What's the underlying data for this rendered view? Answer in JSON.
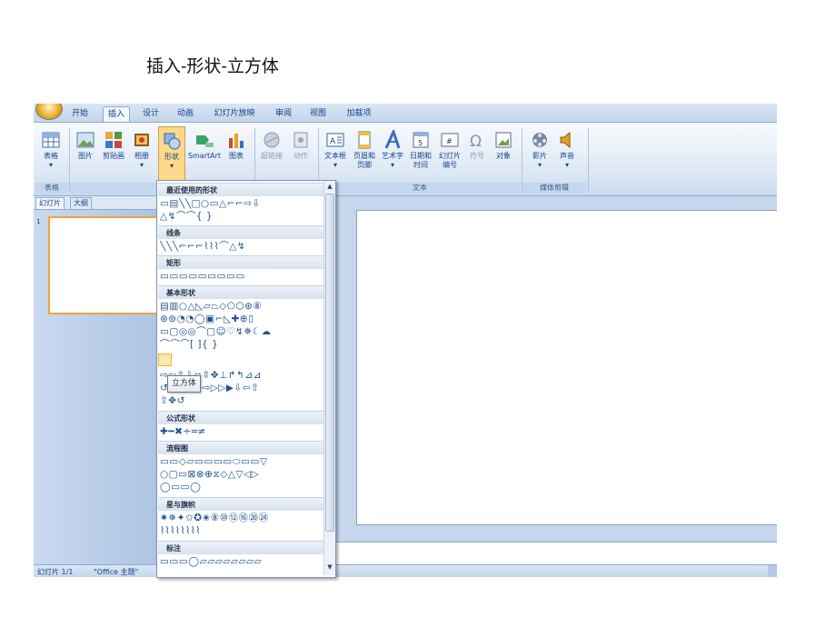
{
  "caption": "插入-形状-立方体",
  "tabs": [
    {
      "label": "开始"
    },
    {
      "label": "插入"
    },
    {
      "label": "设计"
    },
    {
      "label": "动画"
    },
    {
      "label": "幻灯片放映"
    },
    {
      "label": "审阅"
    },
    {
      "label": "视图"
    },
    {
      "label": "加载项"
    }
  ],
  "ribbon": {
    "table": {
      "label": "表格",
      "group": "表格"
    },
    "picture": {
      "label": "图片"
    },
    "clipart": {
      "label": "剪贴画"
    },
    "album": {
      "label": "相册"
    },
    "shapes": {
      "label": "形状"
    },
    "smartart": {
      "label": "SmartArt"
    },
    "chart": {
      "label": "图表"
    },
    "hyperlink": {
      "label": "超链接"
    },
    "action": {
      "label": "动作"
    },
    "textbox": {
      "label": "文本框"
    },
    "header": {
      "label1": "页眉和",
      "label2": "页脚"
    },
    "wordart": {
      "label": "艺术字"
    },
    "datetime": {
      "label1": "日期和",
      "label2": "时间"
    },
    "slidenum": {
      "label1": "幻灯片",
      "label2": "编号"
    },
    "symbol": {
      "label": "符号"
    },
    "object": {
      "label": "对象"
    },
    "movie": {
      "label": "影片"
    },
    "sound": {
      "label": "声音"
    },
    "group_text": "文本",
    "group_media": "媒体剪辑",
    "group_illus_partial": "插"
  },
  "pane": {
    "tab_slides": "幻灯片",
    "tab_outline": "大纲",
    "slide_number": "1"
  },
  "status": {
    "slide": "幻灯片 1/1",
    "theme": "\"Office 主题\""
  },
  "shapes_menu": {
    "sections": [
      {
        "title": "最近使用的形状",
        "rows": [
          "▭▤╲╲□○▭△⌐⌐⇨⇩",
          "△↯⌒⌒{ }"
        ]
      },
      {
        "title": "线条",
        "rows": [
          "╲╲╲⌐⌐⌐⌇⌇⌇⌒△↯"
        ]
      },
      {
        "title": "矩形",
        "rows": [
          "▭▭▭▭▭▭▭▭▭"
        ]
      },
      {
        "title": "基本形状",
        "rows": [
          "▤▥○△◺▱⏢◇⬠⬡⊛⑧",
          "⊛⊚◔◔◯▣⌐◺✚⊕▯",
          "▭▢◎◎⌒▢☺♡↯✵☾☁",
          "⌒⌒⌒[ ]{ }"
        ]
      },
      {
        "title": "",
        "rows": [
          "⇨⇦⇧⇩⬄⇳✥⊥↱↰⊿⊿",
          "↺↻↶↷⇨⇨▷▷▶⇩⇦⇧",
          "⇧✥↺"
        ]
      },
      {
        "title": "公式形状",
        "rows": [
          "✚━✖÷═≠"
        ]
      },
      {
        "title": "流程图",
        "rows": [
          "▭▭◇▱▭▭▭▭⬭▭▭▽",
          "○▢▭⊠⊗⊕⧖◇△▽◁▷",
          "◯▭▭◯"
        ]
      },
      {
        "title": "星与旗帜",
        "rows": [
          "✷✵✦✩✪✬⑧⑩⑫⑯⑳㉔",
          "⌇⌇⌇⌇⌇⌇⌇⌇"
        ]
      },
      {
        "title": "标注",
        "rows": [
          "▭▭▭◯▱▱▱▱▱▱▱▱"
        ]
      }
    ],
    "tooltip": "立方体"
  }
}
